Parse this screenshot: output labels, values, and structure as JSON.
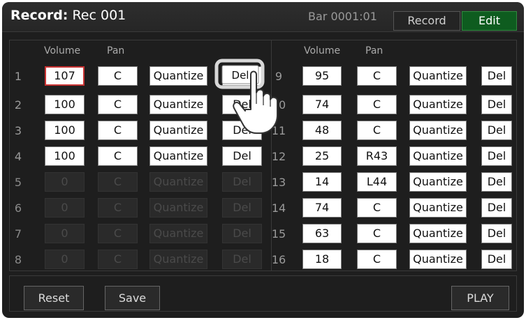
{
  "header": {
    "title_prefix": "Record:",
    "title_name": "Rec 001",
    "bar_position": "Bar 0001:01",
    "record_label": "Record",
    "edit_label": "Edit"
  },
  "columns": {
    "volume": "Volume",
    "pan": "Pan"
  },
  "tracks_left": [
    {
      "num": "1",
      "volume": "107",
      "pan": "C",
      "quantize": "Quantize",
      "del": "Del"
    },
    {
      "num": "2",
      "volume": "100",
      "pan": "C",
      "quantize": "Quantize",
      "del": "Del"
    },
    {
      "num": "3",
      "volume": "100",
      "pan": "C",
      "quantize": "Quantize",
      "del": "Del"
    },
    {
      "num": "4",
      "volume": "100",
      "pan": "C",
      "quantize": "Quantize",
      "del": "Del"
    },
    {
      "num": "5",
      "volume": "0",
      "pan": "C",
      "quantize": "Quantize",
      "del": "Del"
    },
    {
      "num": "6",
      "volume": "0",
      "pan": "C",
      "quantize": "Quantize",
      "del": "Del"
    },
    {
      "num": "7",
      "volume": "0",
      "pan": "C",
      "quantize": "Quantize",
      "del": "Del"
    },
    {
      "num": "8",
      "volume": "0",
      "pan": "C",
      "quantize": "Quantize",
      "del": "Del"
    }
  ],
  "tracks_right": [
    {
      "num": "9",
      "volume": "95",
      "pan": "C",
      "quantize": "Quantize",
      "del": "Del"
    },
    {
      "num": "10",
      "volume": "74",
      "pan": "C",
      "quantize": "Quantize",
      "del": "Del"
    },
    {
      "num": "11",
      "volume": "48",
      "pan": "C",
      "quantize": "Quantize",
      "del": "Del"
    },
    {
      "num": "12",
      "volume": "25",
      "pan": "R43",
      "quantize": "Quantize",
      "del": "Del"
    },
    {
      "num": "13",
      "volume": "14",
      "pan": "L44",
      "quantize": "Quantize",
      "del": "Del"
    },
    {
      "num": "14",
      "volume": "74",
      "pan": "C",
      "quantize": "Quantize",
      "del": "Del"
    },
    {
      "num": "15",
      "volume": "63",
      "pan": "C",
      "quantize": "Quantize",
      "del": "Del"
    },
    {
      "num": "16",
      "volume": "18",
      "pan": "C",
      "quantize": "Quantize",
      "del": "Del"
    }
  ],
  "bottom": {
    "reset_label": "Reset",
    "save_label": "Save",
    "play_label": "PLAY"
  },
  "pointer_icon": "hand-pointer-icon",
  "colors": {
    "edit_active": "#0e5c1f",
    "selected_border": "#c83232",
    "background": "#1e1e1e"
  }
}
